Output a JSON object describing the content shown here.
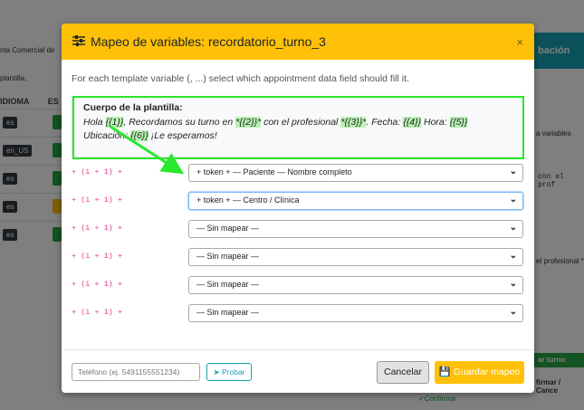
{
  "background": {
    "header_left_text": "nta Comercial de",
    "sub_left_text": "plantilla.",
    "col_idioma": "IDIOMA",
    "col_es": "ES",
    "rows": [
      {
        "lang": "es",
        "status": "green"
      },
      {
        "lang": "en_US",
        "status": "green"
      },
      {
        "lang": "es",
        "status": "green"
      },
      {
        "lang": "es",
        "status": "yellow"
      },
      {
        "lang": "es",
        "status": "green"
      }
    ],
    "right_header": "bación",
    "right_text_1": "a variables",
    "right_text_2": "con el prof",
    "right_text_3": "el profesional *",
    "right_green_bar": "ar turno",
    "right_text_4": "firmar / Cance",
    "right_confirm": "✓Confirmar"
  },
  "modal": {
    "title": "Mapeo de variables: recordatorio_turno_3",
    "title_icon": "sliders-icon",
    "close_label": "×",
    "subtitle": "For each template variable (, ...) select which appointment data field should fill it.",
    "template": {
      "heading": "Cuerpo de la plantilla:",
      "body_parts": [
        {
          "t": "Hola ",
          "hl": false
        },
        {
          "t": "{{1}}",
          "hl": true
        },
        {
          "t": ", Recordamos su turno en ",
          "hl": false
        },
        {
          "t": "*{{2}}*",
          "hl": true
        },
        {
          "t": " con el profesional ",
          "hl": false
        },
        {
          "t": "*{{3}}*",
          "hl": true
        },
        {
          "t": ". Fecha: ",
          "hl": false
        },
        {
          "t": "{{4}}",
          "hl": true
        },
        {
          "t": " Hora: ",
          "hl": false
        },
        {
          "t": "{{5}}",
          "hl": true
        },
        {
          "t": " Ubicación: ",
          "hl": false
        },
        {
          "t": "{{6}}",
          "hl": true
        },
        {
          "t": " ¡Le esperamos!",
          "hl": false
        }
      ]
    },
    "mappings": [
      {
        "label": "+ (i + 1) +",
        "value": "+ token + — Paciente — Nombre completo",
        "focused": false
      },
      {
        "label": "+ (i + 1) +",
        "value": "+ token + — Centro / Clínica",
        "focused": true
      },
      {
        "label": "+ (i + 1) +",
        "value": "— Sin mapear —",
        "focused": false
      },
      {
        "label": "+ (i + 1) +",
        "value": "— Sin mapear —",
        "focused": false
      },
      {
        "label": "+ (i + 1) +",
        "value": "— Sin mapear —",
        "focused": false
      },
      {
        "label": "+ (i + 1) +",
        "value": "— Sin mapear —",
        "focused": false
      }
    ],
    "footer": {
      "phone_placeholder": "Teléfono (ej. 5491155551234)",
      "probar_label": "Probar",
      "cancel_label": "Cancelar",
      "save_label": "Guardar mapeo"
    }
  },
  "colors": {
    "header": "#ffc107",
    "highlight": "#b9f3b4",
    "annotation": "#27e82a",
    "mono_label": "#e83e8c",
    "info": "#17a2b8"
  }
}
